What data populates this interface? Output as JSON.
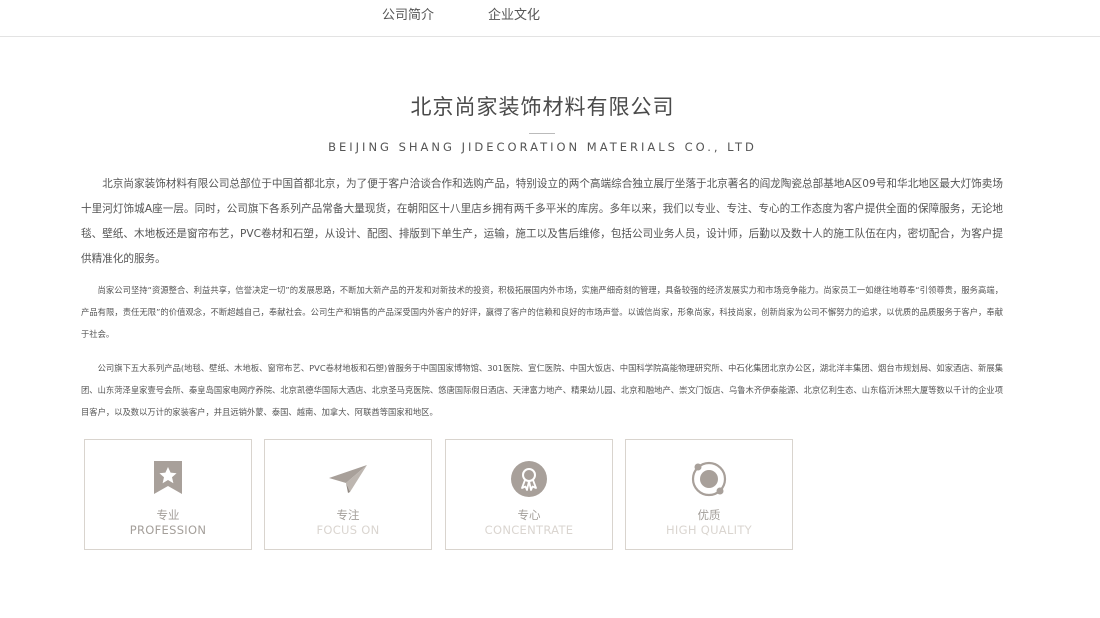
{
  "nav": {
    "items": [
      {
        "label": "公司简介"
      },
      {
        "label": "企业文化"
      }
    ]
  },
  "company": {
    "title": "北京尚家装饰材料有限公司",
    "subtitle": "BEIJING SHANG JIDECORATION MATERIALS CO., LTD"
  },
  "paragraphs": [
    "北京尚家装饰材料有限公司总部位于中国首都北京，为了便于客户洽谈合作和选购产品，特别设立的两个高端综合独立展厅坐落于北京著名的阎龙陶瓷总部基地A区09号和华北地区最大灯饰卖场十里河灯饰城A座一层。同时，公司旗下各系列产品常备大量现货，在朝阳区十八里店乡拥有两千多平米的库房。多年以来，我们以专业、专注、专心的工作态度为客户提供全面的保障服务，无论地毯、壁纸、木地板还是窗帘布艺，PVC卷材和石塑，从设计、配图、排版到下单生产，运输，施工以及售后维修，包括公司业务人员，设计师，后勤以及数十人的施工队伍在内，密切配合，为客户提供精准化的服务。",
    "尚家公司坚持“资源整合、利益共享，信誉决定一切”的发展思路，不断加大新产品的开发和对新技术的投资，积极拓展国内外市场，实施严细奇刻的管理，具备较强的经济发展实力和市场竞争能力。尚家员工一如继往地尊奉“引领尊贵，服务高端，产品有限，责任无限”的价值观念，不断超越自己，奉献社会。公司生产和销售的产品深受国内外客户的好评，赢得了客户的信赖和良好的市场声誉。以诚信尚家，形象尚家，科技尚家，创新尚家为公司不懈努力的追求，以优质的品质服务于客户，奉献于社会。",
    "公司旗下五大系列产品(地毯、壁纸、木地板、窗帘布艺、PVC卷材地板和石塑)曾服务于中国国家博物馆、301医院、宣仁医院、中国大饭店、中国科学院高能物理研究所、中石化集团北京办公区，湖北洋丰集团、烟台市规划局、如家酒店、新展集团、山东菏泽皇家壹号会所、秦皇岛国家电网疗养院、北京凯德华国际大酒店、北京圣马克医院、悠唐国际假日酒店、天津富力地产、精果幼儿园、北京和融地产、崇文门饭店、乌鲁木齐伊泰能源、北京亿利生态、山东临沂沐熙大厦等数以千计的企业项目客户，以及数以万计的家装客户，并且远销外蒙、泰国、越南、加拿大、阿联酋等国家和地区。"
  ],
  "features": [
    {
      "cn": "专业",
      "en": "PROFESSION",
      "icon": "star-badge-icon"
    },
    {
      "cn": "专注",
      "en": "FOCUS ON",
      "icon": "paper-plane-icon"
    },
    {
      "cn": "专心",
      "en": "CONCENTRATE",
      "icon": "award-medal-icon"
    },
    {
      "cn": "优质",
      "en": "HIGH QUALITY",
      "icon": "orbit-quality-icon"
    }
  ],
  "colors": {
    "icon": "#a8a09a",
    "text": "#555555",
    "border": "#d9d4ce"
  }
}
